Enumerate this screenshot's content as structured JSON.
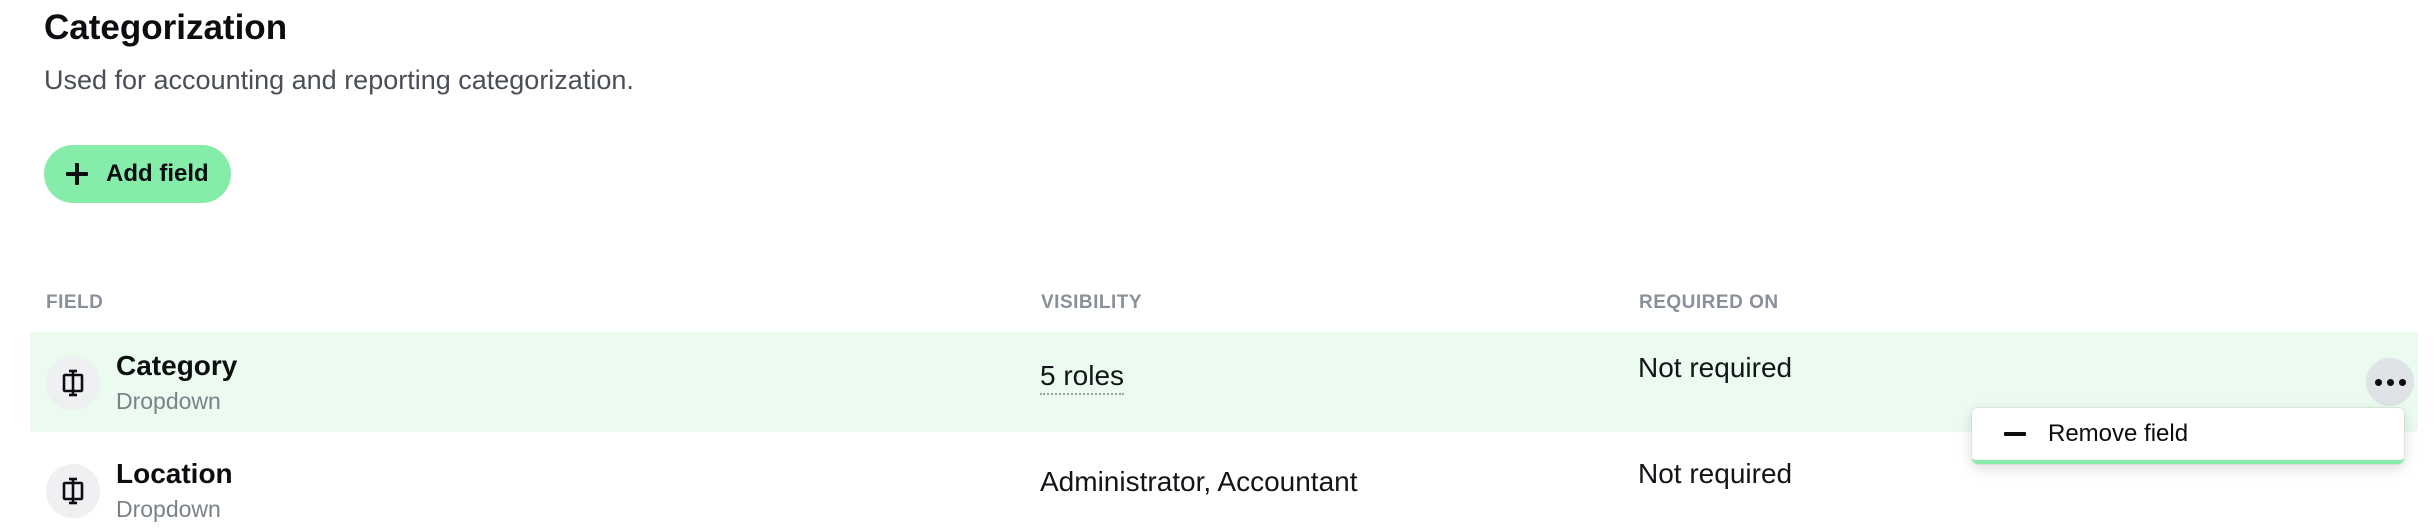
{
  "header": {
    "title": "Categorization",
    "subtitle": "Used for accounting and reporting categorization."
  },
  "toolbar": {
    "add_label": "Add field",
    "add_icon": "plus-icon"
  },
  "table": {
    "columns": [
      "FIELD",
      "VISIBILITY",
      "REQUIRED ON"
    ],
    "rows": [
      {
        "name": "Category",
        "type": "Dropdown",
        "visibility": "5 roles",
        "required": "Not required",
        "icon": "dropdown-field-icon",
        "highlighted": true
      },
      {
        "name": "Location",
        "type": "Dropdown",
        "visibility": "Administrator, Accountant",
        "required": "Not required",
        "icon": "dropdown-field-icon",
        "highlighted": false
      }
    ]
  },
  "menu": {
    "remove_label": "Remove field",
    "remove_icon": "minus-icon"
  },
  "colors": {
    "accent": "#86ecaa",
    "row_highlight": "#ebfbef",
    "muted_text": "#8a9099"
  }
}
